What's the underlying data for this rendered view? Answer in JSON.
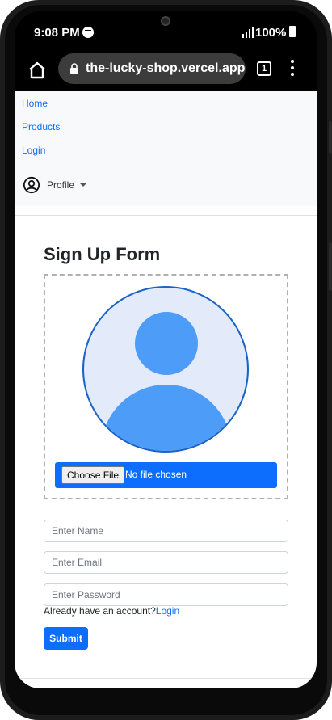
{
  "status_bar": {
    "time": "9:08 PM",
    "battery": "100%"
  },
  "browser": {
    "url": "the-lucky-shop.vercel.app",
    "tab_count": "1"
  },
  "navbar": {
    "links": [
      "Home",
      "Products",
      "Login"
    ],
    "profile_label": "Profile"
  },
  "form": {
    "title": "Sign Up Form",
    "file_button_label": "Choose File",
    "file_status": "No file chosen",
    "name_placeholder": "Enter Name",
    "email_placeholder": "Enter Email",
    "password_placeholder": "Enter Password",
    "login_prompt": "Already have an account?",
    "login_link": "Login",
    "submit_label": "Submit"
  },
  "colors": {
    "primary": "#0d6efd",
    "avatar_fill": "#4d9cf8",
    "avatar_bg": "#e3ebfb",
    "navbar_bg": "#f8f9fa"
  },
  "icons": {
    "home": "home-icon",
    "lock": "lock-icon",
    "profile": "user-circle-icon"
  }
}
